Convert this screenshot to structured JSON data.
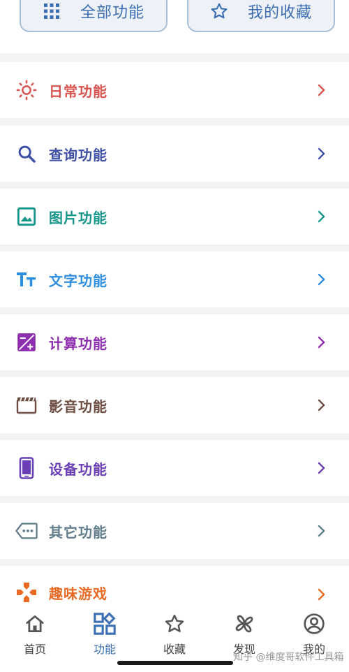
{
  "top_buttons": {
    "all_label": "全部功能",
    "fav_label": "我的收藏",
    "accent": "#3c6fb4"
  },
  "categories": [
    {
      "label": "日常功能",
      "icon": "sun-icon",
      "color": "#d9534f"
    },
    {
      "label": "查询功能",
      "icon": "search-icon",
      "color": "#3f51a5"
    },
    {
      "label": "图片功能",
      "icon": "image-icon",
      "color": "#16968a"
    },
    {
      "label": "文字功能",
      "icon": "text-icon",
      "color": "#2e8ee0"
    },
    {
      "label": "计算功能",
      "icon": "calculator-icon",
      "color": "#8e2fb0"
    },
    {
      "label": "影音功能",
      "icon": "clapperboard-icon",
      "color": "#6d4c41"
    },
    {
      "label": "设备功能",
      "icon": "phone-icon",
      "color": "#6a3fb5"
    },
    {
      "label": "其它功能",
      "icon": "tag-dots-icon",
      "color": "#607d8b"
    },
    {
      "label": "趣味游戏",
      "icon": "gamepad-icon",
      "color": "#e86a25"
    }
  ],
  "tabbar": {
    "tabs": [
      {
        "label": "首页",
        "icon": "home-icon"
      },
      {
        "label": "功能",
        "icon": "grid-icon"
      },
      {
        "label": "收藏",
        "icon": "star-icon"
      },
      {
        "label": "发现",
        "icon": "pinwheel-icon"
      },
      {
        "label": "我的",
        "icon": "user-icon"
      }
    ],
    "active_color": "#3c6fb4"
  },
  "watermark": "知乎 @维度哥软件工具箱"
}
